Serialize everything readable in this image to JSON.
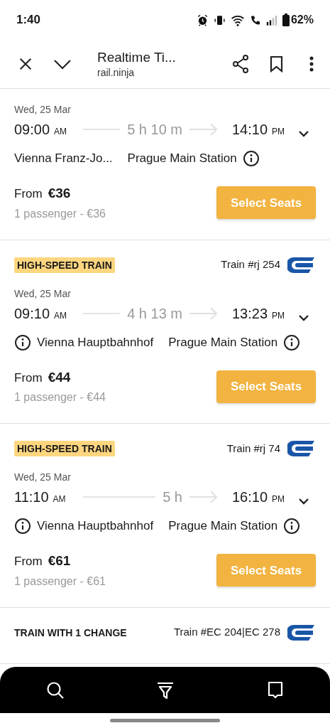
{
  "status_bar": {
    "time": "1:40",
    "battery": "62%"
  },
  "toolbar": {
    "title": "Realtime Ti...",
    "url": "rail.ninja"
  },
  "trips": [
    {
      "date": "Wed, 25 Mar",
      "depart": "09:00",
      "depart_period": "AM",
      "duration": "5 h 10 m",
      "arrive": "14:10",
      "arrive_period": "PM",
      "from": {
        "name": "Vienna Franz-Jo...",
        "info": false
      },
      "to": {
        "name": "Prague Main Station",
        "info": true
      },
      "price_label": "From",
      "price": "€36",
      "passengers": "1 passenger - €36",
      "button": "Select Seats"
    },
    {
      "tag": {
        "text": "HIGH-SPEED TRAIN",
        "kind": "highlight"
      },
      "train": "Train #rj 254",
      "date": "Wed, 25 Mar",
      "depart": "09:10",
      "depart_period": "AM",
      "duration": "4 h 13 m",
      "arrive": "13:23",
      "arrive_period": "PM",
      "from": {
        "name": "Vienna Hauptbahnhof",
        "info": true
      },
      "to": {
        "name": "Prague Main Station",
        "info": true
      },
      "price_label": "From",
      "price": "€44",
      "passengers": "1 passenger - €44",
      "button": "Select Seats"
    },
    {
      "tag": {
        "text": "HIGH-SPEED TRAIN",
        "kind": "highlight"
      },
      "train": "Train #rj 74",
      "date": "Wed, 25 Mar",
      "depart": "11:10",
      "depart_period": "AM",
      "duration": "5 h",
      "arrive": "16:10",
      "arrive_period": "PM",
      "from": {
        "name": "Vienna Hauptbahnhof",
        "info": true
      },
      "to": {
        "name": "Prague Main Station",
        "info": true
      },
      "price_label": "From",
      "price": "€61",
      "passengers": "1 passenger - €61",
      "button": "Select Seats"
    },
    {
      "tag": {
        "text": "TRAIN WITH 1 CHANGE",
        "kind": "plain"
      },
      "train": "Train #EC 204|EC 278"
    }
  ]
}
